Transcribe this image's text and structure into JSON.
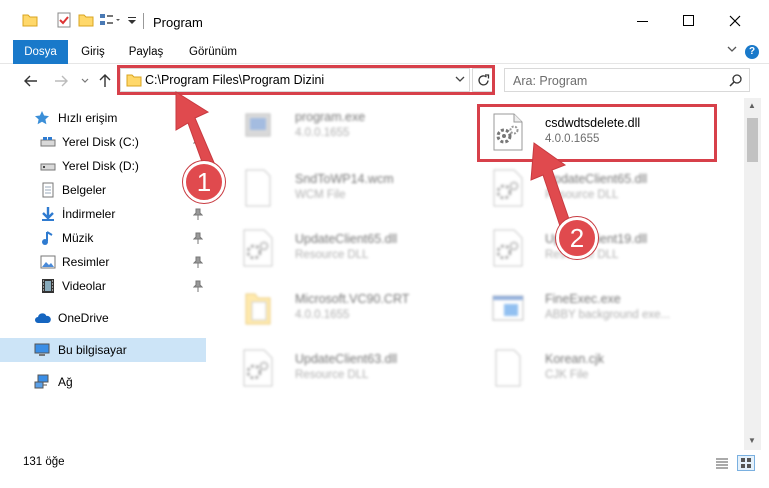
{
  "window": {
    "title": "Program"
  },
  "ribbon": {
    "tabs": [
      "Dosya",
      "Giriş",
      "Paylaş",
      "Görünüm"
    ]
  },
  "address": {
    "path": "C:\\Program Files\\Program Dizini"
  },
  "search": {
    "placeholder": "Ara: Program"
  },
  "sidebar": {
    "items": [
      {
        "label": "Hızlı erişim",
        "icon": "star-icon",
        "pinned": false
      },
      {
        "label": "Yerel Disk (C:)",
        "icon": "drive-icon",
        "pinned": true
      },
      {
        "label": "Yerel Disk (D:)",
        "icon": "drive-icon",
        "pinned": false
      },
      {
        "label": "Belgeler",
        "icon": "documents-icon",
        "pinned": true
      },
      {
        "label": "İndirmeler",
        "icon": "download-icon",
        "pinned": true
      },
      {
        "label": "Müzik",
        "icon": "music-icon",
        "pinned": true
      },
      {
        "label": "Resimler",
        "icon": "pictures-icon",
        "pinned": true
      },
      {
        "label": "Videolar",
        "icon": "video-icon",
        "pinned": true
      },
      {
        "label": "OneDrive",
        "icon": "cloud-icon",
        "pinned": false
      },
      {
        "label": "Bu bilgisayar",
        "icon": "computer-icon",
        "pinned": false
      },
      {
        "label": "Ağ",
        "icon": "network-icon",
        "pinned": false
      }
    ]
  },
  "files": [
    {
      "name": "program.exe",
      "meta": "4.0.0.1655",
      "icon": "exe-icon"
    },
    {
      "name": "csdwdtsdelete.dll",
      "meta": "4.0.0.1655",
      "icon": "dll-gear-icon"
    },
    {
      "name": "SndToWP14.wcm",
      "meta": "WCM File",
      "icon": "file-icon"
    },
    {
      "name": "UpdateClient65.dll",
      "meta": "Resource DLL",
      "icon": "dll-gear-icon"
    },
    {
      "name": "UpdateClient65.dll",
      "meta": "Resource DLL",
      "icon": "dll-gear-icon"
    },
    {
      "name": "UpdateClient19.dll",
      "meta": "Resource DLL",
      "icon": "dll-gear-icon"
    },
    {
      "name": "Microsoft.VC90.CRT",
      "meta": "4.0.0.1655",
      "icon": "folder-icon"
    },
    {
      "name": "FineExec.exe",
      "meta": "ABBY background exe...",
      "icon": "exe-window-icon"
    },
    {
      "name": "UpdateClient63.dll",
      "meta": "Resource DLL",
      "icon": "dll-gear-icon"
    },
    {
      "name": "Korean.cjk",
      "meta": "CJK File",
      "icon": "file-icon"
    }
  ],
  "status": {
    "count": "131 öğe"
  },
  "annotations": {
    "badge1": "1",
    "badge2": "2",
    "color": "#d7404a"
  },
  "colors": {
    "accent": "#1979ca",
    "selection": "#cce4f7"
  }
}
